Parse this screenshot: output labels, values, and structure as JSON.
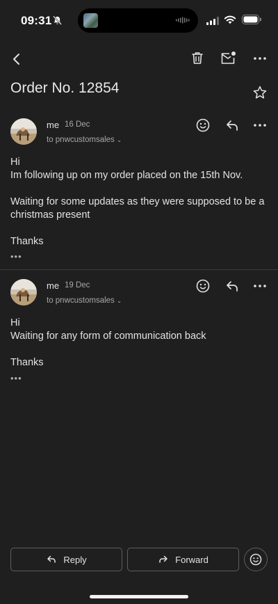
{
  "status_bar": {
    "time": "09:31",
    "icons": [
      "bell-slash-icon",
      "signal-icon",
      "wifi-icon",
      "battery-icon"
    ]
  },
  "toolbar": {
    "icons": [
      "back-arrow-icon",
      "trash-icon",
      "mark-unread-icon",
      "more-icon"
    ]
  },
  "subject": "Order No. 12854",
  "messages": [
    {
      "sender": "me",
      "date": "16 Dec",
      "recipient": "to pnwcustomsales",
      "body": "Hi\nIm following up on my order placed on the 15th Nov.\n\nWaiting for some updates as they were supposed to be a christmas present\n\nThanks",
      "quote_toggle": "•••"
    },
    {
      "sender": "me",
      "date": "19 Dec",
      "recipient": "to pnwcustomsales",
      "body": "Hi\nWaiting for any form of communication back\n\nThanks",
      "quote_toggle": "•••"
    }
  ],
  "actions": {
    "reply": "Reply",
    "forward": "Forward"
  },
  "colors": {
    "background": "#1f1f1f",
    "text": "#e3e3e3",
    "secondary_text": "#a8a8a8",
    "border": "#5e5e5e"
  }
}
